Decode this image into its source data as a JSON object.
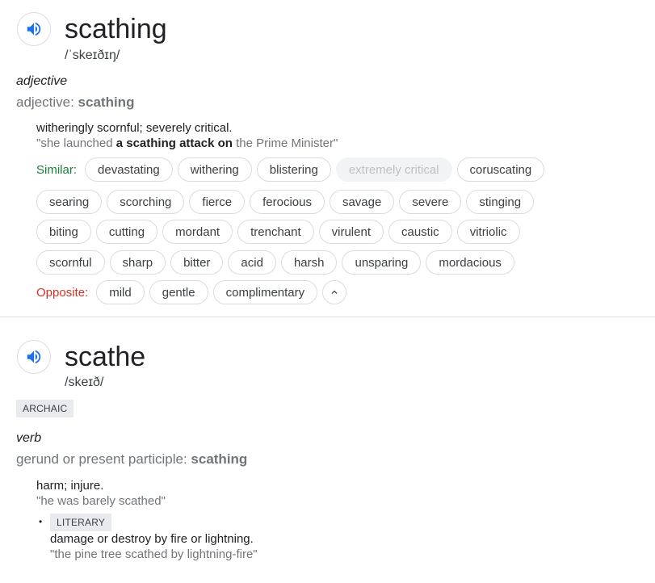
{
  "entry1": {
    "headword": "scathing",
    "phonetic": "/ˈskeɪðɪŋ/",
    "pos": "adjective",
    "form_label": "adjective: ",
    "form_word": "scathing",
    "definition": "witheringly scornful; severely critical.",
    "example_pre": "\"she launched ",
    "example_bold": "a scathing attack on",
    "example_post": " the Prime Minister\"",
    "similar_label": "Similar:",
    "similar_row1": [
      {
        "label": "devastating",
        "disabled": false
      },
      {
        "label": "withering",
        "disabled": false
      },
      {
        "label": "blistering",
        "disabled": false
      },
      {
        "label": "extremely critical",
        "disabled": true
      },
      {
        "label": "coruscating",
        "disabled": false
      }
    ],
    "similar_row2": [
      "searing",
      "scorching",
      "fierce",
      "ferocious",
      "savage",
      "severe",
      "stinging"
    ],
    "similar_row3": [
      "biting",
      "cutting",
      "mordant",
      "trenchant",
      "virulent",
      "caustic",
      "vitriolic"
    ],
    "similar_row4": [
      "scornful",
      "sharp",
      "bitter",
      "acid",
      "harsh",
      "unsparing",
      "mordacious"
    ],
    "opposite_label": "Opposite:",
    "opposite": [
      "mild",
      "gentle",
      "complimentary"
    ],
    "collapse_icon": "chevron-up-icon"
  },
  "entry2": {
    "headword": "scathe",
    "phonetic": "/skeɪð/",
    "register": "ARCHAIC",
    "pos": "verb",
    "form_label": "gerund or present participle: ",
    "form_word": "scathing",
    "definition1": "harm; injure.",
    "example1": "\"he was barely scathed\"",
    "bullet": "•",
    "sub_register": "LITERARY",
    "definition2": "damage or destroy by fire or lightning.",
    "example2": "\"the pine tree scathed by lightning-fire\""
  },
  "icons": {
    "speaker": "speaker-icon"
  },
  "colors": {
    "accent": "#1a73e8",
    "similar": "#188038",
    "opposite": "#d93025",
    "muted": "#70757a"
  }
}
